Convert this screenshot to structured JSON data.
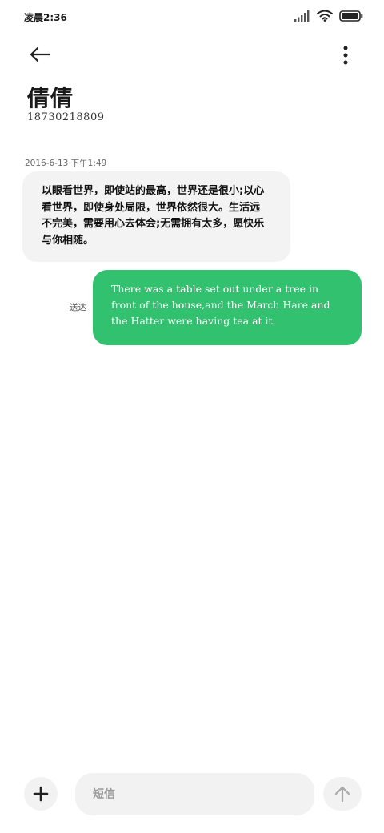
{
  "status_bar": {
    "time": "凌晨2:36",
    "icons": [
      "signal-icon",
      "wifi-icon",
      "battery-icon"
    ]
  },
  "header": {
    "back_icon": "arrow-left-icon",
    "more_icon": "more-vertical-icon",
    "contact_name": "倩倩",
    "contact_number": "18730218809"
  },
  "conversation": {
    "timestamp": "2016-6-13 下午1:49",
    "received_message": "以眼看世界，即使站的最高，世界还是很小;以心看世界，即使身处局限，世界依然很大。生活远不完美，需要用心去体会;无需拥有太多，愿快乐与你相随。",
    "sent_status": "送达",
    "sent_message": "There was a table set out under a tree in front of the house,and the March Hare and the Hatter were having tea at it."
  },
  "composer": {
    "add_icon": "plus-icon",
    "placeholder": "短信",
    "value": "",
    "send_icon": "arrow-up-icon"
  },
  "colors": {
    "sent_bubble": "#32c16f",
    "received_bubble": "#f3f3f3",
    "input_background": "#f2f2f2"
  }
}
